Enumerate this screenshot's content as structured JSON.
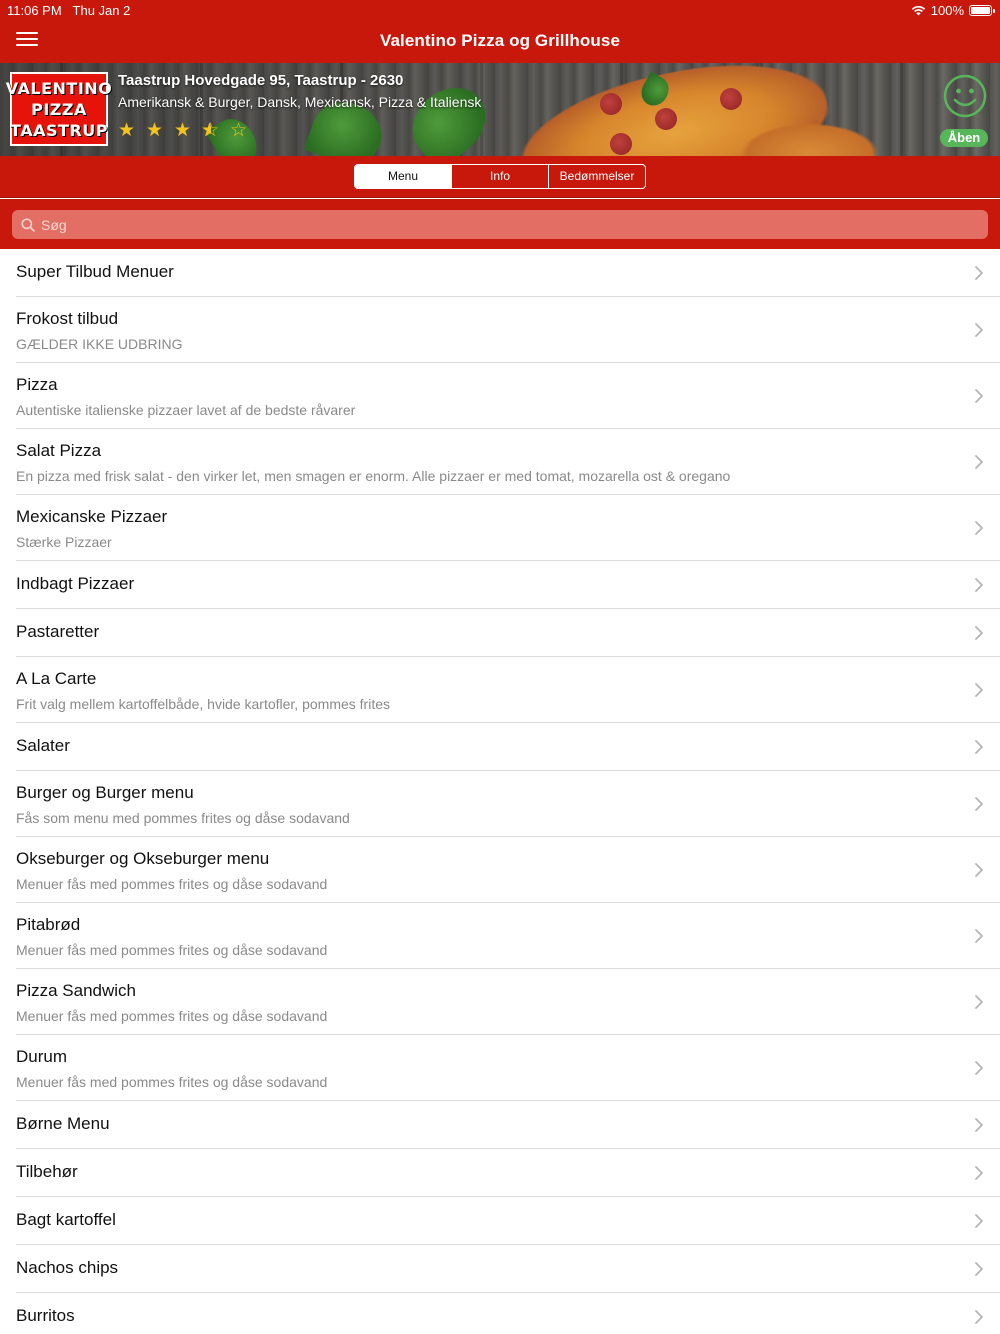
{
  "status": {
    "time": "11:06 PM",
    "date": "Thu Jan 2",
    "battery": "100%"
  },
  "nav": {
    "title": "Valentino Pizza og Grillhouse"
  },
  "restaurant": {
    "logo_lines": [
      "VALENTINO",
      "PIZZA",
      "TAASTRUP"
    ],
    "address": "Taastrup Hovedgade 95, Taastrup - 2630",
    "cuisine": "Amerikansk & Burger, Dansk, Mexicansk, Pizza & Italiensk",
    "rating": 3.5,
    "status_label": "Åben"
  },
  "colors": {
    "brand": "#c8170b",
    "open": "#57b65a",
    "star": "#f3c419"
  },
  "tabs": [
    {
      "label": "Menu",
      "active": true
    },
    {
      "label": "Info",
      "active": false
    },
    {
      "label": "Bedømmelser",
      "active": false
    }
  ],
  "search": {
    "placeholder": "Søg"
  },
  "menu": [
    {
      "title": "Super Tilbud Menuer",
      "subtitle": ""
    },
    {
      "title": "Frokost tilbud",
      "subtitle": "GÆLDER IKKE UDBRING"
    },
    {
      "title": "Pizza",
      "subtitle": "Autentiske italienske pizzaer lavet af de bedste råvarer"
    },
    {
      "title": "Salat Pizza",
      "subtitle": "En pizza med frisk salat - den virker let, men smagen er enorm. Alle pizzaer er med tomat, mozarella ost & oregano"
    },
    {
      "title": "Mexicanske Pizzaer",
      "subtitle": "Stærke Pizzaer"
    },
    {
      "title": "Indbagt Pizzaer",
      "subtitle": ""
    },
    {
      "title": "Pastaretter",
      "subtitle": ""
    },
    {
      "title": "A La Carte",
      "subtitle": "Frit valg mellem kartoffelbåde, hvide kartofler, pommes frites"
    },
    {
      "title": "Salater",
      "subtitle": ""
    },
    {
      "title": "Burger og Burger menu",
      "subtitle": "Fås som menu med pommes frites og dåse sodavand"
    },
    {
      "title": "Okseburger og Okseburger menu",
      "subtitle": "Menuer fås med pommes frites og dåse sodavand"
    },
    {
      "title": "Pitabrød",
      "subtitle": "Menuer fås med pommes frites og dåse sodavand"
    },
    {
      "title": "Pizza Sandwich",
      "subtitle": "Menuer fås med pommes frites og dåse sodavand"
    },
    {
      "title": "Durum",
      "subtitle": "Menuer fås med pommes frites og dåse sodavand"
    },
    {
      "title": "Børne Menu",
      "subtitle": ""
    },
    {
      "title": "Tilbehør",
      "subtitle": ""
    },
    {
      "title": "Bagt kartoffel",
      "subtitle": ""
    },
    {
      "title": "Nachos chips",
      "subtitle": ""
    },
    {
      "title": "Burritos",
      "subtitle": ""
    }
  ]
}
